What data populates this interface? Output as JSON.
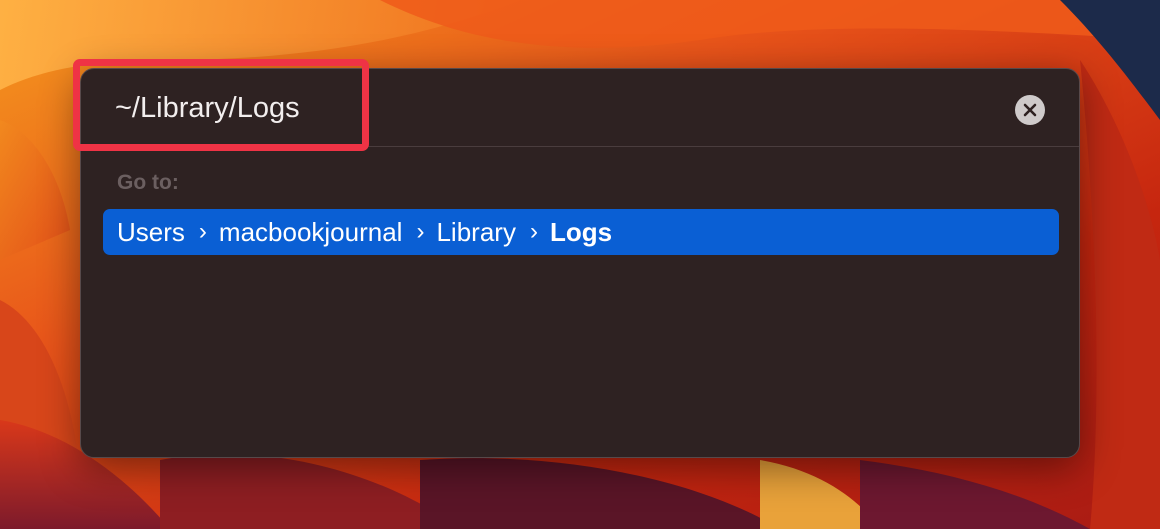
{
  "dialog": {
    "path_value": "~/Library/Logs",
    "goto_label": "Go to:",
    "clear_icon": "close-circle-icon",
    "result": {
      "crumbs": [
        "Users",
        "macbookjournal",
        "Library"
      ],
      "current": "Logs",
      "separator": "›"
    }
  },
  "colors": {
    "selection": "#0a5fd4",
    "highlight": "#ef3345",
    "dialog_bg": "#2e2222"
  }
}
